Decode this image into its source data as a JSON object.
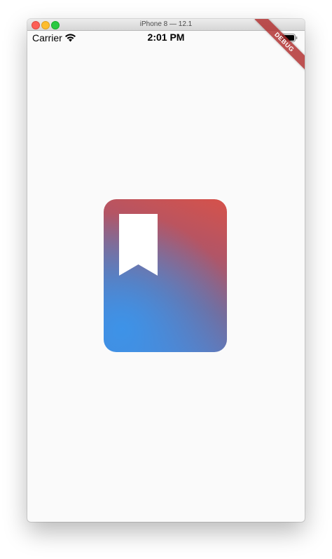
{
  "window": {
    "title": "iPhone 8 — 12.1"
  },
  "status_bar": {
    "carrier": "Carrier",
    "time": "2:01 PM"
  },
  "debug_banner": {
    "label": "DEBUG"
  },
  "colors": {
    "background": "#fafafa",
    "gradient_top_right": "#d6524a",
    "gradient_bottom_left": "#3d93e8",
    "banner": "#b02c2c"
  },
  "icons": {
    "center": "bookmark-book-icon",
    "wifi": "wifi-icon",
    "battery": "battery-icon"
  }
}
